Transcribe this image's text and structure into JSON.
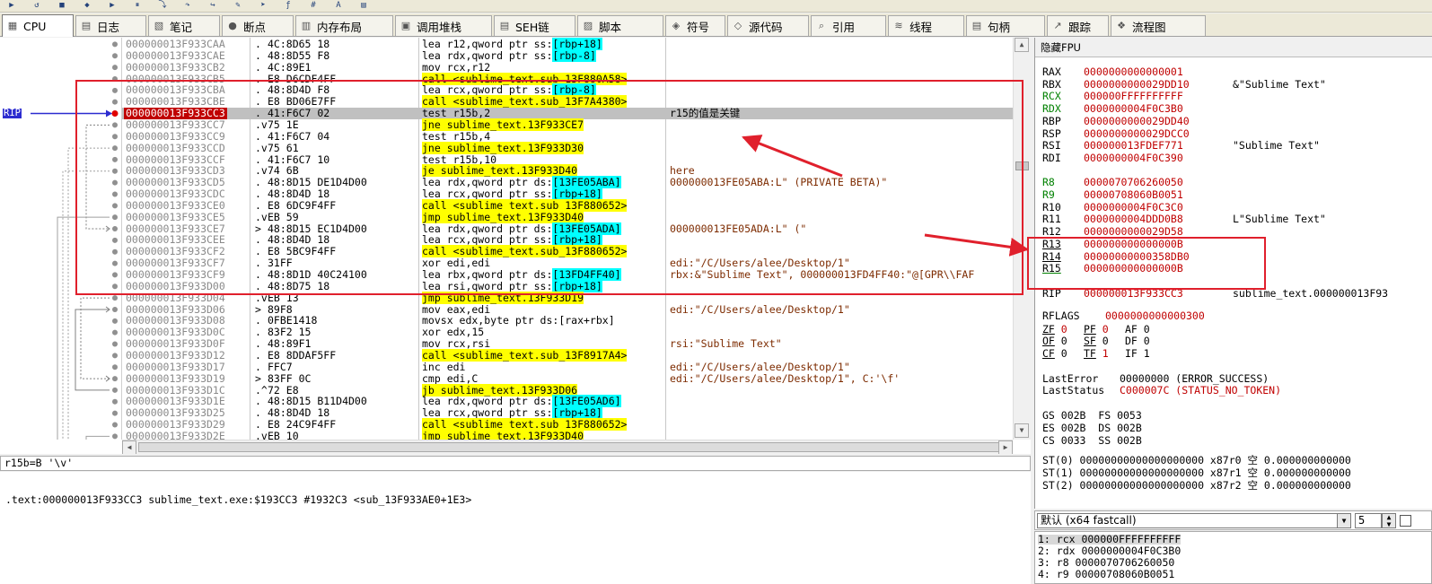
{
  "tabs": [
    {
      "label": "CPU",
      "icon": "cpu-icon"
    },
    {
      "label": "日志",
      "icon": "log-icon"
    },
    {
      "label": "笔记",
      "icon": "notes-icon"
    },
    {
      "label": "断点",
      "icon": "breakpoint-icon"
    },
    {
      "label": "内存布局",
      "icon": "memory-map-icon"
    },
    {
      "label": "调用堆栈",
      "icon": "call-stack-icon"
    },
    {
      "label": "SEH链",
      "icon": "seh-icon"
    },
    {
      "label": "脚本",
      "icon": "script-icon"
    },
    {
      "label": "符号",
      "icon": "symbols-icon"
    },
    {
      "label": "源代码",
      "icon": "source-icon"
    },
    {
      "label": "引用",
      "icon": "references-icon"
    },
    {
      "label": "线程",
      "icon": "threads-icon"
    },
    {
      "label": "句柄",
      "icon": "handles-icon"
    },
    {
      "label": "跟踪",
      "icon": "trace-icon"
    },
    {
      "label": "流程图",
      "icon": "graph-icon"
    }
  ],
  "rip_label": "RIP",
  "disasm": [
    {
      "addr": "000000013F933CAA",
      "bp": ".",
      "bytes": "4C:8D65 18",
      "instr": [
        {
          "t": "lea r12,qword ptr ss:"
        },
        {
          "t": "[rbp+18]",
          "c": "hlc"
        }
      ],
      "cmt": ""
    },
    {
      "addr": "000000013F933CAE",
      "bp": ".",
      "bytes": "48:8D55 F8",
      "instr": [
        {
          "t": "lea rdx,qword ptr ss:"
        },
        {
          "t": "[rbp-8]",
          "c": "hlc"
        }
      ],
      "cmt": ""
    },
    {
      "addr": "000000013F933CB2",
      "bp": ".",
      "bytes": "4C:89E1",
      "instr": [
        {
          "t": "mov rcx,r12"
        }
      ],
      "cmt": ""
    },
    {
      "addr": "000000013F933CB5",
      "bp": ".",
      "bytes": "E8 D6CDF4FF",
      "instr": [
        {
          "t": "call <sublime_text.sub_13F880A58>",
          "c": "hl"
        }
      ],
      "cmt": ""
    },
    {
      "addr": "000000013F933CBA",
      "bp": ".",
      "bytes": "48:8D4D F8",
      "instr": [
        {
          "t": "lea rcx,qword ptr ss:"
        },
        {
          "t": "[rbp-8]",
          "c": "hlc"
        }
      ],
      "cmt": ""
    },
    {
      "addr": "000000013F933CBE",
      "bp": ".",
      "bytes": "E8 BD06E7FF",
      "instr": [
        {
          "t": "call <sublime_text.sub_13F7A4380>",
          "c": "hl"
        }
      ],
      "cmt": ""
    },
    {
      "addr": "000000013F933CC3",
      "bp": ".",
      "bytes": "41:F6C7 02",
      "instr": [
        {
          "t": "test r15b,2"
        }
      ],
      "cmt": "r15的值是关键",
      "rip": true
    },
    {
      "addr": "000000013F933CC7",
      "bp": ".v",
      "bytes": "75 1E",
      "instr": [
        {
          "t": "jne sublime_text.13F933CE7",
          "c": "hl"
        }
      ],
      "cmt": ""
    },
    {
      "addr": "000000013F933CC9",
      "bp": ".",
      "bytes": "41:F6C7 04",
      "instr": [
        {
          "t": "test r15b,4"
        }
      ],
      "cmt": ""
    },
    {
      "addr": "000000013F933CCD",
      "bp": ".v",
      "bytes": "75 61",
      "instr": [
        {
          "t": "jne sublime_text.13F933D30",
          "c": "hl"
        }
      ],
      "cmt": ""
    },
    {
      "addr": "000000013F933CCF",
      "bp": ".",
      "bytes": "41:F6C7 10",
      "instr": [
        {
          "t": "test r15b,10"
        }
      ],
      "cmt": ""
    },
    {
      "addr": "000000013F933CD3",
      "bp": ".v",
      "bytes": "74 6B",
      "instr": [
        {
          "t": "je sublime_text.13F933D40",
          "c": "hl"
        }
      ],
      "cmt": "here"
    },
    {
      "addr": "000000013F933CD5",
      "bp": ".",
      "bytes": "48:8D15 DE1D4D00",
      "instr": [
        {
          "t": "lea rdx,qword ptr ds:"
        },
        {
          "t": "[13FE05ABA]",
          "c": "hlc"
        }
      ],
      "cmt": "000000013FE05ABA:L\" (PRIVATE BETA)\""
    },
    {
      "addr": "000000013F933CDC",
      "bp": ".",
      "bytes": "48:8D4D 18",
      "instr": [
        {
          "t": "lea rcx,qword ptr ss:"
        },
        {
          "t": "[rbp+18]",
          "c": "hlc"
        }
      ],
      "cmt": ""
    },
    {
      "addr": "000000013F933CE0",
      "bp": ".",
      "bytes": "E8 6DC9F4FF",
      "instr": [
        {
          "t": "call <sublime_text.sub_13F880652>",
          "c": "hl"
        }
      ],
      "cmt": ""
    },
    {
      "addr": "000000013F933CE5",
      "bp": ".v",
      "bytes": "EB 59",
      "instr": [
        {
          "t": "jmp sublime_text.13F933D40",
          "c": "hl"
        }
      ],
      "cmt": ""
    },
    {
      "addr": "000000013F933CE7",
      "bp": ">",
      "bytes": "48:8D15 EC1D4D00",
      "instr": [
        {
          "t": "lea rdx,qword ptr ds:"
        },
        {
          "t": "[13FE05ADA]",
          "c": "hlc"
        }
      ],
      "cmt": "000000013FE05ADA:L\" (\""
    },
    {
      "addr": "000000013F933CEE",
      "bp": ".",
      "bytes": "48:8D4D 18",
      "instr": [
        {
          "t": "lea rcx,qword ptr ss:"
        },
        {
          "t": "[rbp+18]",
          "c": "hlc"
        }
      ],
      "cmt": ""
    },
    {
      "addr": "000000013F933CF2",
      "bp": ".",
      "bytes": "E8 5BC9F4FF",
      "instr": [
        {
          "t": "call <sublime_text.sub_13F880652>",
          "c": "hl"
        }
      ],
      "cmt": ""
    },
    {
      "addr": "000000013F933CF7",
      "bp": ".",
      "bytes": "31FF",
      "instr": [
        {
          "t": "xor edi,edi"
        }
      ],
      "cmt": "edi:\"/C/Users/alee/Desktop/1\""
    },
    {
      "addr": "000000013F933CF9",
      "bp": ".",
      "bytes": "48:8D1D 40C24100",
      "instr": [
        {
          "t": "lea rbx,qword ptr ds:"
        },
        {
          "t": "[13FD4FF40]",
          "c": "hlc"
        }
      ],
      "cmt": "rbx:&\"Sublime Text\", 000000013FD4FF40:\"@[GPR\\\\FAF"
    },
    {
      "addr": "000000013F933D00",
      "bp": ".",
      "bytes": "48:8D75 18",
      "instr": [
        {
          "t": "lea rsi,qword ptr ss:"
        },
        {
          "t": "[rbp+18]",
          "c": "hlc"
        }
      ],
      "cmt": ""
    },
    {
      "addr": "000000013F933D04",
      "bp": ".v",
      "bytes": "EB 13",
      "instr": [
        {
          "t": "jmp sublime_text.13F933D19",
          "c": "hl"
        }
      ],
      "cmt": ""
    },
    {
      "addr": "000000013F933D06",
      "bp": ">",
      "bytes": "89F8",
      "instr": [
        {
          "t": "mov eax,edi"
        }
      ],
      "cmt": "edi:\"/C/Users/alee/Desktop/1\""
    },
    {
      "addr": "000000013F933D08",
      "bp": ".",
      "bytes": "0FBE1418",
      "instr": [
        {
          "t": "movsx edx,byte ptr ds:[rax+rbx]"
        }
      ],
      "cmt": ""
    },
    {
      "addr": "000000013F933D0C",
      "bp": ".",
      "bytes": "83F2 15",
      "instr": [
        {
          "t": "xor edx,15"
        }
      ],
      "cmt": ""
    },
    {
      "addr": "000000013F933D0F",
      "bp": ".",
      "bytes": "48:89F1",
      "instr": [
        {
          "t": "mov rcx,rsi"
        }
      ],
      "cmt": "rsi:\"Sublime Text\""
    },
    {
      "addr": "000000013F933D12",
      "bp": ".",
      "bytes": "E8 8DDAF5FF",
      "instr": [
        {
          "t": "call <sublime_text.sub_13F8917A4>",
          "c": "hl"
        }
      ],
      "cmt": ""
    },
    {
      "addr": "000000013F933D17",
      "bp": ".",
      "bytes": "FFC7",
      "instr": [
        {
          "t": "inc edi"
        }
      ],
      "cmt": "edi:\"/C/Users/alee/Desktop/1\""
    },
    {
      "addr": "000000013F933D19",
      "bp": ">",
      "bytes": "83FF 0C",
      "instr": [
        {
          "t": "cmp edi,C"
        }
      ],
      "cmt": "edi:\"/C/Users/alee/Desktop/1\", C:'\\f'"
    },
    {
      "addr": "000000013F933D1C",
      "bp": ".^",
      "bytes": "72 E8",
      "instr": [
        {
          "t": "jb sublime_text.13F933D06",
          "c": "hl"
        }
      ],
      "cmt": ""
    },
    {
      "addr": "000000013F933D1E",
      "bp": ".",
      "bytes": "48:8D15 B11D4D00",
      "instr": [
        {
          "t": "lea rdx,qword ptr ds:"
        },
        {
          "t": "[13FE05AD6]",
          "c": "hlc"
        }
      ],
      "cmt": ""
    },
    {
      "addr": "000000013F933D25",
      "bp": ".",
      "bytes": "48:8D4D 18",
      "instr": [
        {
          "t": "lea rcx,qword ptr ss:"
        },
        {
          "t": "[rbp+18]",
          "c": "hlc"
        }
      ],
      "cmt": ""
    },
    {
      "addr": "000000013F933D29",
      "bp": ".",
      "bytes": "E8 24C9F4FF",
      "instr": [
        {
          "t": "call <sublime_text.sub_13F880652>",
          "c": "hl"
        }
      ],
      "cmt": ""
    },
    {
      "addr": "000000013F933D2E",
      "bp": ".v",
      "bytes": "EB 10",
      "instr": [
        {
          "t": "jmp sublime_text.13F933D40",
          "c": "hl"
        }
      ],
      "cmt": ""
    }
  ],
  "info_bar": "r15b=B '\\v'",
  "info_text": ".text:000000013F933CC3 sublime_text.exe:$193CC3 #1932C3 <sub_13F933AE0+1E3>",
  "reg_header": "隐藏FPU",
  "registers": [
    {
      "n": "RAX",
      "v": "0000000000000001",
      "c": ""
    },
    {
      "n": "RBX",
      "v": "0000000000029DD10",
      "c": "&\"Sublime Text\""
    },
    {
      "n": "RCX",
      "v": "000000FFFFFFFFFF",
      "c": "",
      "g": 1
    },
    {
      "n": "RDX",
      "v": "0000000004F0C3B0",
      "c": "",
      "g": 1
    },
    {
      "n": "RBP",
      "v": "0000000000029DD40",
      "c": ""
    },
    {
      "n": "RSP",
      "v": "0000000000029DCC0",
      "c": ""
    },
    {
      "n": "RSI",
      "v": "000000013FDEF771",
      "c": "\"Sublime Text\""
    },
    {
      "n": "RDI",
      "v": "0000000004F0C390",
      "c": ""
    },
    {
      "n": "",
      "v": "",
      "c": ""
    },
    {
      "n": "R8",
      "v": "0000070706260050",
      "c": "",
      "g": 1
    },
    {
      "n": "R9",
      "v": "00000708060B0051",
      "c": "",
      "g": 1
    },
    {
      "n": "R10",
      "v": "0000000004F0C3C0",
      "c": ""
    },
    {
      "n": "R11",
      "v": "0000000004DDD0B8",
      "c": "L\"Sublime Text\""
    },
    {
      "n": "R12",
      "v": "0000000000029D58",
      "c": ""
    },
    {
      "n": "R13",
      "v": "000000000000000B",
      "c": ""
    },
    {
      "n": "R14",
      "v": "00000000000358DB0",
      "c": ""
    },
    {
      "n": "R15",
      "v": "000000000000000B",
      "c": ""
    },
    {
      "n": "",
      "v": "",
      "c": ""
    },
    {
      "n": "RIP",
      "v": "000000013F933CC3",
      "c": "sublime_text.000000013F93"
    }
  ],
  "rflags": {
    "n": "RFLAGS",
    "v": "0000000000000300"
  },
  "flags": [
    [
      {
        "n": "ZF",
        "v": "0",
        "r": 1
      },
      {
        "n": "PF",
        "v": "0",
        "r": 1
      },
      {
        "n": "AF",
        "v": "0"
      }
    ],
    [
      {
        "n": "OF",
        "v": "0"
      },
      {
        "n": "SF",
        "v": "0"
      },
      {
        "n": "DF",
        "v": "0"
      }
    ],
    [
      {
        "n": "CF",
        "v": "0"
      },
      {
        "n": "TF",
        "v": "1",
        "r": 1
      },
      {
        "n": "IF",
        "v": "1"
      }
    ]
  ],
  "last_error": {
    "label": "LastError",
    "v": "00000000 (ERROR_SUCCESS)"
  },
  "last_status": {
    "label": "LastStatus",
    "v": "C000007C (STATUS_NO_TOKEN)"
  },
  "segs": [
    "GS 002B  FS 0053",
    "ES 002B  DS 002B",
    "CS 0033  SS 002B"
  ],
  "fpu": [
    "ST(0) 00000000000000000000 x87r0 空 0.000000000000",
    "ST(1) 00000000000000000000 x87r1 空 0.000000000000",
    "ST(2) 00000000000000000000 x87r2 空 0.000000000000"
  ],
  "callconv": {
    "value": "默认 (x64 fastcall)",
    "count": "5"
  },
  "args": [
    "1: rcx 000000FFFFFFFFFF",
    "2: rdx 0000000004F0C3B0",
    "3: r8 0000070706260050",
    "4: r9 00000708060B0051"
  ],
  "colors": {
    "accent_red": "#e0202c",
    "rip_blue": "#2c2cd0",
    "highlight_yellow": "#ffff00",
    "highlight_cyan": "#00ffff"
  }
}
